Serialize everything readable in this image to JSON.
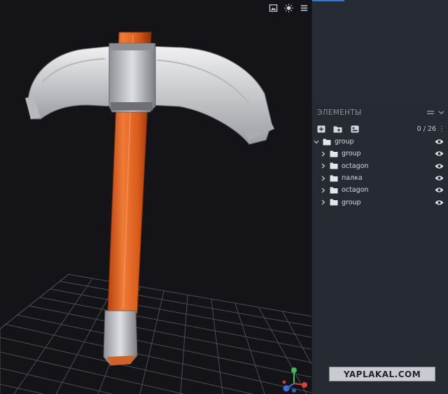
{
  "viewport": {
    "toolbar_icons": [
      "image-icon",
      "sun-icon",
      "menu-icon"
    ]
  },
  "elements_panel": {
    "title": "ЭЛЕМЕНТЫ",
    "count": "0 / 26",
    "root": {
      "label": "group",
      "expanded": true
    },
    "children": [
      {
        "label": "group"
      },
      {
        "label": "octagon"
      },
      {
        "label": "палка"
      },
      {
        "label": "octagon"
      },
      {
        "label": "group"
      }
    ]
  },
  "watermark": {
    "text": "YAPLAKAL.COM"
  },
  "colors": {
    "viewport_bg": "#141418",
    "panel_bg": "#262a33",
    "handle": "#d4581e",
    "metal": "#d8d9dc",
    "grid": "#5a5d66",
    "accent": "#3a78c4"
  }
}
